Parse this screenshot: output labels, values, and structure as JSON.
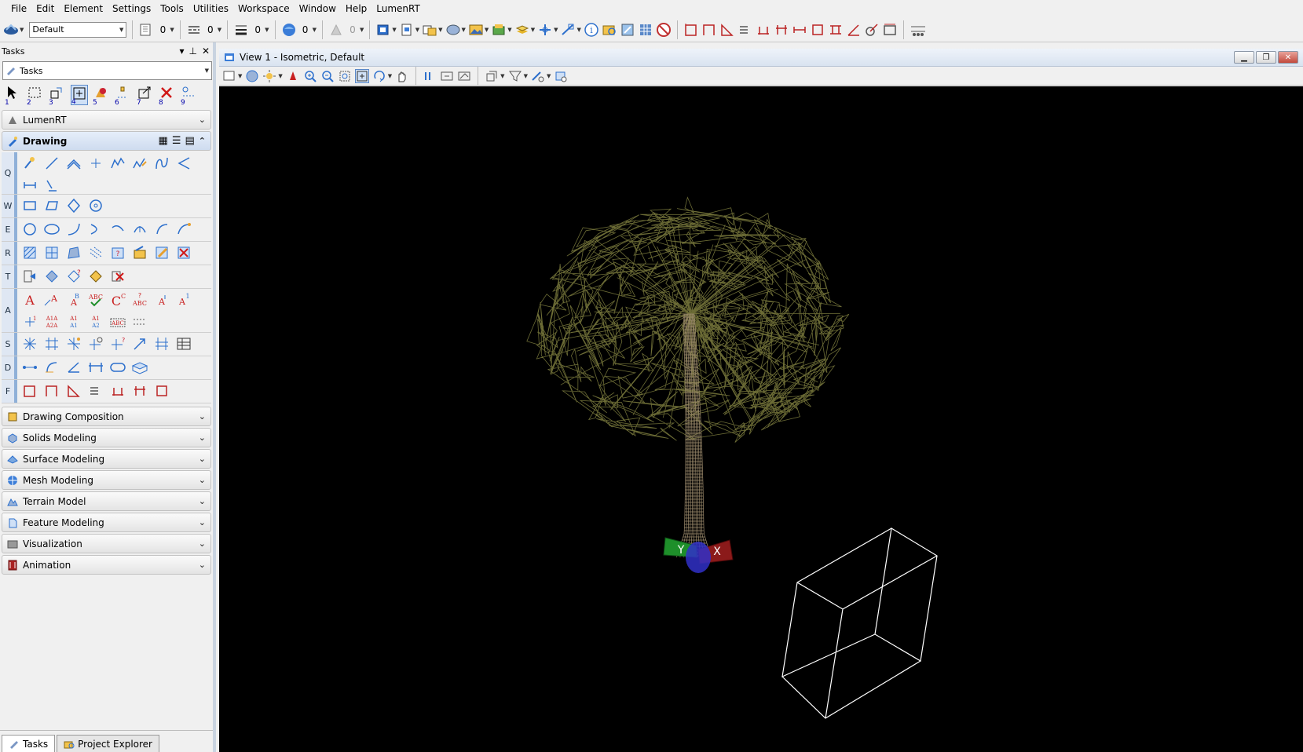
{
  "menu": [
    "File",
    "Edit",
    "Element",
    "Settings",
    "Tools",
    "Utilities",
    "Workspace",
    "Window",
    "Help",
    "LumenRT"
  ],
  "toolbar": {
    "level_combo": "Default",
    "counts": [
      "0",
      "0",
      "0",
      "0",
      "0"
    ]
  },
  "tasks_panel": {
    "title": "Tasks",
    "combo_value": "Tasks",
    "tool_numbers": [
      "1",
      "2",
      "3",
      "4",
      "5",
      "6",
      "7",
      "8",
      "9"
    ],
    "sections_top": [
      {
        "label": "LumenRT",
        "icon": "lumenrt-icon"
      }
    ],
    "active_section": "Drawing",
    "drawing_rows": [
      "Q",
      "W",
      "E",
      "R",
      "T",
      "A",
      "S",
      "D",
      "F"
    ],
    "sections_bottom": [
      {
        "label": "Drawing Composition",
        "icon": "drawing-composition-icon"
      },
      {
        "label": "Solids Modeling",
        "icon": "solids-modeling-icon"
      },
      {
        "label": "Surface Modeling",
        "icon": "surface-modeling-icon"
      },
      {
        "label": "Mesh Modeling",
        "icon": "mesh-modeling-icon"
      },
      {
        "label": "Terrain Model",
        "icon": "terrain-model-icon"
      },
      {
        "label": "Feature Modeling",
        "icon": "feature-modeling-icon"
      },
      {
        "label": "Visualization",
        "icon": "visualization-icon"
      },
      {
        "label": "Animation",
        "icon": "animation-icon"
      }
    ],
    "bottom_tabs": [
      "Tasks",
      "Project Explorer"
    ]
  },
  "view": {
    "title": "View 1 - Isometric, Default",
    "axis_labels": {
      "x": "X",
      "y": "Y"
    }
  },
  "colors": {
    "viewport_bg": "#000000",
    "foliage": "#6b6b35",
    "trunk": "#9c8a6c",
    "box": "#ffffff",
    "axis_x": "#8b1a1a",
    "axis_y": "#1e8f2a",
    "axis_z": "#3030c8"
  }
}
